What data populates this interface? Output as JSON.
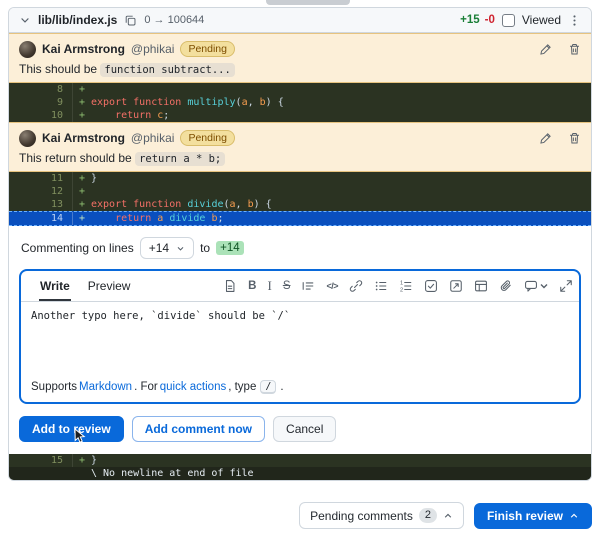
{
  "file_header": {
    "path": "lib/lib/index.js",
    "mode_change": "0 → 100644",
    "additions": "+15",
    "deletions": "-0",
    "viewed_label": "Viewed"
  },
  "comments": [
    {
      "author": "Kai Armstrong",
      "handle": "@phikai",
      "badge": "Pending",
      "text": "This should be ",
      "code": "function subtract..."
    },
    {
      "author": "Kai Armstrong",
      "handle": "@phikai",
      "badge": "Pending",
      "text": "This return should be ",
      "code": "return a * b;"
    }
  ],
  "diff": {
    "blocks": [
      {
        "rows": [
          {
            "num": "8",
            "sign": "+",
            "tokens": []
          },
          {
            "num": "9",
            "sign": "+",
            "tokens": [
              {
                "t": "export",
                "c": "kw"
              },
              {
                "t": " ",
                "c": "pl"
              },
              {
                "t": "function",
                "c": "kw"
              },
              {
                "t": " ",
                "c": "pl"
              },
              {
                "t": "multiply",
                "c": "fn"
              },
              {
                "t": "(",
                "c": "pl"
              },
              {
                "t": "a",
                "c": "pr"
              },
              {
                "t": ", ",
                "c": "pl"
              },
              {
                "t": "b",
                "c": "pr"
              },
              {
                "t": ") {",
                "c": "pl"
              }
            ]
          },
          {
            "num": "10",
            "sign": "+",
            "tokens": [
              {
                "t": "    ",
                "c": "pl"
              },
              {
                "t": "return",
                "c": "kw"
              },
              {
                "t": " ",
                "c": "pl"
              },
              {
                "t": "c",
                "c": "pr"
              },
              {
                "t": ";",
                "c": "pl"
              }
            ]
          }
        ]
      },
      {
        "rows": [
          {
            "num": "11",
            "sign": "+",
            "tokens": [
              {
                "t": "}",
                "c": "pl"
              }
            ]
          },
          {
            "num": "12",
            "sign": "+",
            "tokens": []
          },
          {
            "num": "13",
            "sign": "+",
            "tokens": [
              {
                "t": "export",
                "c": "kw"
              },
              {
                "t": " ",
                "c": "pl"
              },
              {
                "t": "function",
                "c": "kw"
              },
              {
                "t": " ",
                "c": "pl"
              },
              {
                "t": "divide",
                "c": "fn"
              },
              {
                "t": "(",
                "c": "pl"
              },
              {
                "t": "a",
                "c": "pr"
              },
              {
                "t": ", ",
                "c": "pl"
              },
              {
                "t": "b",
                "c": "pr"
              },
              {
                "t": ") {",
                "c": "pl"
              }
            ]
          },
          {
            "num": "14",
            "sign": "+",
            "selected": true,
            "tokens": [
              {
                "t": "    ",
                "c": "pl"
              },
              {
                "t": "return",
                "c": "kw"
              },
              {
                "t": " ",
                "c": "pl"
              },
              {
                "t": "a",
                "c": "pr"
              },
              {
                "t": " ",
                "c": "pl"
              },
              {
                "t": "divide",
                "c": "fn"
              },
              {
                "t": " ",
                "c": "pl"
              },
              {
                "t": "b",
                "c": "pr"
              },
              {
                "t": ";",
                "c": "pl"
              }
            ]
          }
        ]
      },
      {
        "rows": [
          {
            "num": "15",
            "sign": "+",
            "tokens": [
              {
                "t": "}",
                "c": "pl"
              }
            ]
          },
          {
            "no_newline": true,
            "tokens": [
              {
                "t": "\\ No newline at end of file",
                "c": "nn"
              }
            ]
          }
        ]
      }
    ]
  },
  "commenting": {
    "label": "Commenting on lines",
    "from": "+14",
    "to_word": "to",
    "to": "+14"
  },
  "editor": {
    "tabs": [
      {
        "label": "Write"
      },
      {
        "label": "Preview"
      }
    ],
    "toolbar": [
      "file",
      "bold",
      "italic",
      "strikethrough",
      "quote",
      "code",
      "link",
      "list-unordered",
      "list-ordered",
      "tasklist",
      "cross-reference",
      "table",
      "paperclip",
      "saved-reply",
      "fullscreen"
    ],
    "content": "Another typo here, `divide` should be `/`",
    "footer": {
      "supports": "Supports ",
      "markdown_link": "Markdown",
      "mid": ". For ",
      "quick_actions_link": "quick actions",
      "type_text": ", type ",
      "kbd": "/",
      "end": "."
    }
  },
  "buttons": {
    "add_to_review": "Add to review",
    "add_comment_now": "Add comment now",
    "cancel": "Cancel"
  },
  "review_footer": {
    "pending_label": "Pending comments",
    "pending_count": "2",
    "finish_label": "Finish review"
  },
  "colors": {
    "accent": "#0969da",
    "addition_green": "#1a7f37",
    "deletion_red": "#cf222e",
    "pending_bg": "#fcefd8",
    "pending_badge_text": "#7d4e00",
    "code_bg": "#2b3322",
    "selected_line_blue": "#0a4fbe"
  }
}
